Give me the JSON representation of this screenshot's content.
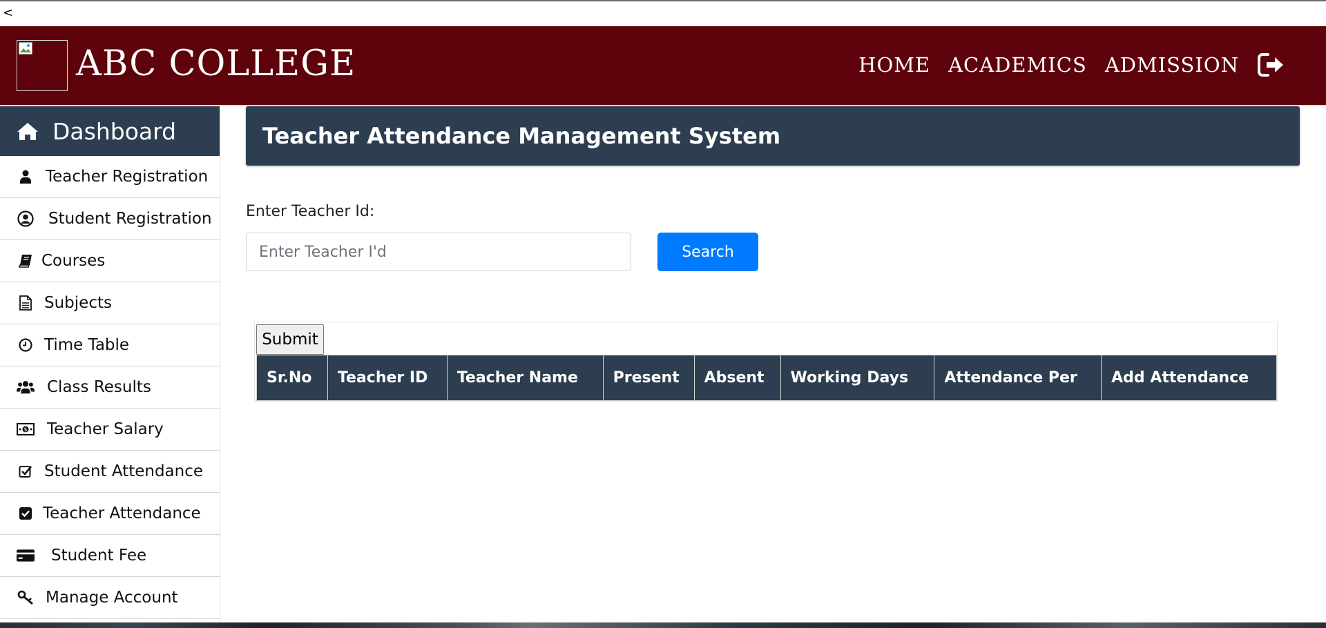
{
  "browser": {
    "back_label": "<"
  },
  "header": {
    "brand": "ABC COLLEGE",
    "nav": [
      "HOME",
      "ACADEMICS",
      "ADMISSION"
    ],
    "colors": {
      "background": "#5e020b",
      "text": "#ffffff"
    }
  },
  "sidebar": {
    "dashboard": {
      "label": "Dashboard",
      "icon": "home-icon"
    },
    "items": [
      {
        "label": "Teacher Registration",
        "icon": "user-icon"
      },
      {
        "label": "Student Registration",
        "icon": "user-circle-icon"
      },
      {
        "label": "Courses",
        "icon": "book-icon"
      },
      {
        "label": "Subjects",
        "icon": "document-icon"
      },
      {
        "label": "Time Table",
        "icon": "clock-icon"
      },
      {
        "label": "Class Results",
        "icon": "users-icon"
      },
      {
        "label": "Teacher Salary",
        "icon": "money-icon"
      },
      {
        "label": "Student Attendance",
        "icon": "check-square-outline-icon"
      },
      {
        "label": "Teacher Attendance",
        "icon": "check-square-icon"
      },
      {
        "label": "Student Fee",
        "icon": "credit-card-icon"
      },
      {
        "label": "Manage Account",
        "icon": "key-icon"
      }
    ]
  },
  "main": {
    "title": "Teacher Attendance Management System",
    "search": {
      "label": "Enter Teacher Id:",
      "placeholder": "Enter Teacher I'd",
      "value": "",
      "button": "Search"
    },
    "submit_label": "Submit",
    "table_headers": [
      "Sr.No",
      "Teacher ID",
      "Teacher Name",
      "Present",
      "Absent",
      "Working Days",
      "Attendance Per",
      "Add Attendance"
    ]
  },
  "theme": {
    "panel": "#2c3e50",
    "primary": "#007bff"
  }
}
